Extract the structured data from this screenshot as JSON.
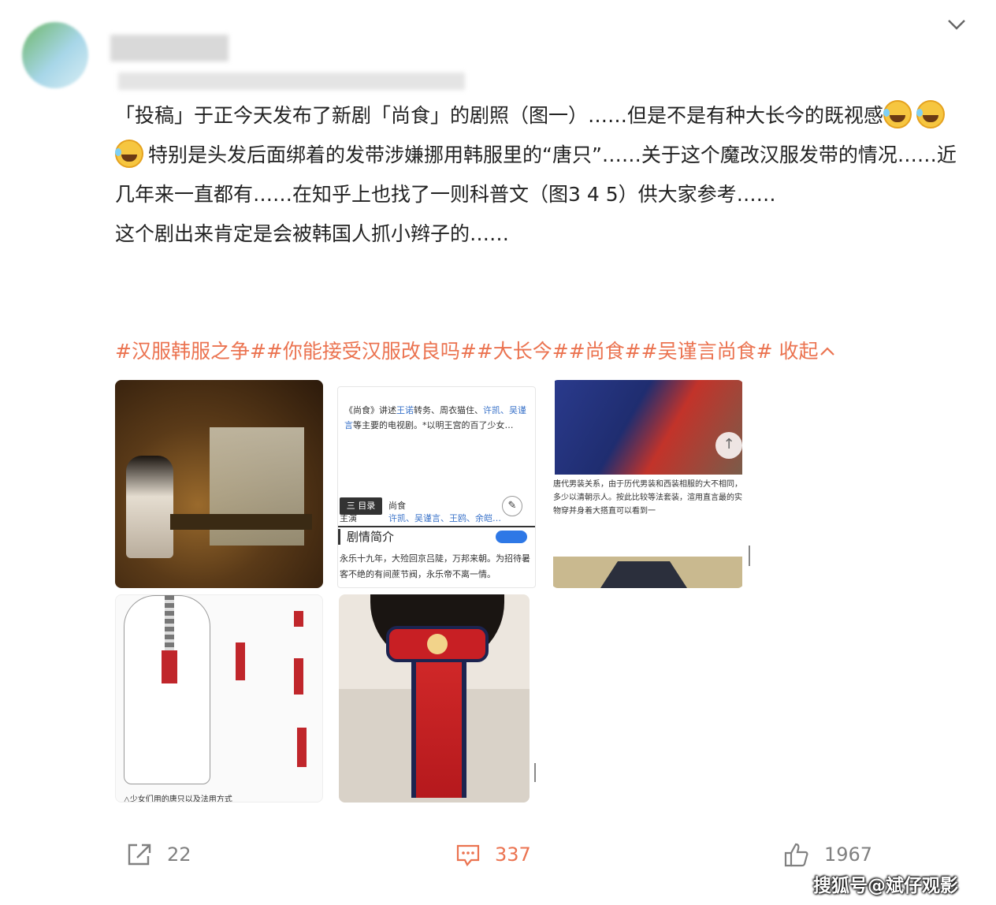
{
  "post": {
    "paragraph1": "「投稿」于正今天发布了新剧「尚食」的剧照（图一）……但是不是有种大长今的既视感",
    "paragraph1_tail": "特别是头发后面绑着的发带涉嫌挪用韩服里的“唐只”……关于这个魔改汉服发带的情况……近几年来一直都有……在知乎上也找了一则科普文（图3 4 5）供大家参考……",
    "paragraph2": "这个剧出来肯定是会被韩国人抓小辫子的……",
    "emoji_icon": "laugh-cry-icon"
  },
  "tags": {
    "items": [
      "#汉服韩服之争#",
      "#你能接受汉服改良吗#",
      "#大长今#",
      "#尚食#",
      "#吴谨言尚食#"
    ],
    "collapse_label": "收起",
    "color": "#eb7350"
  },
  "images": {
    "img2": {
      "text_part1": "《尚食》讲述",
      "link1": "王诺",
      "text_part2": "转务、周衣猫住、",
      "link2": "许凯、吴谨言",
      "text_part3": "等主要的电视剧。*以明王宫的百了少女…",
      "menu_label": "三 目录",
      "tab_label": "尚食",
      "star_label": "主演",
      "links": "许凯、吴谨言、王鸥、余皑…",
      "edit_icon": "pencil-icon",
      "heading": "剧情简介",
      "body": "永乐十九年，大殓回京吕陡，万邦来朝。为招待暑客不绝的有间蔗节阀，永乐帝不离一情。"
    },
    "img3": {
      "caption": "唐代男装关系，由于历代男装和西装相服的大不相同，多少以清朝示人。按此比较等法套装，渲用直言最的实物穿并身着大搭直可以看到一",
      "arrow_icon": "arrow-up-icon"
    },
    "img4": {
      "caption": "△少女们用的唐只以及法用方式"
    }
  },
  "actions": {
    "share_count": "22",
    "comment_count": "337",
    "like_count": "1967",
    "share_icon": "share-icon",
    "comment_icon": "comment-icon",
    "like_icon": "thumbs-up-icon"
  },
  "watermark": "搜狐号@斌仔观影",
  "header": {
    "chevron_icon": "chevron-down-icon"
  }
}
